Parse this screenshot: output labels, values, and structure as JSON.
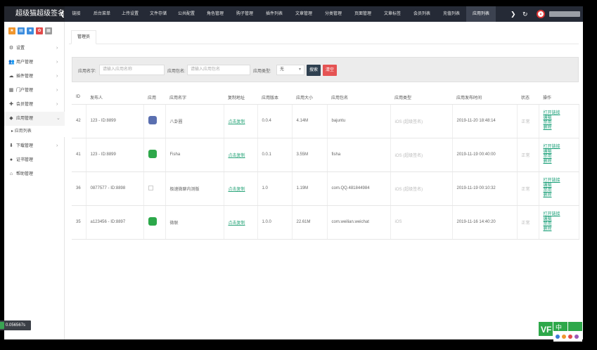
{
  "brand": {
    "title": "超级猫超级签名"
  },
  "nav": {
    "collapse_icon": "chevron-left-icon",
    "items": [
      {
        "label": "链接",
        "active": false
      },
      {
        "label": "后台菜单",
        "active": false
      },
      {
        "label": "上传设置",
        "active": false
      },
      {
        "label": "文件存储",
        "active": false
      },
      {
        "label": "公共配置",
        "active": false
      },
      {
        "label": "角色管理",
        "active": false
      },
      {
        "label": "购子管理",
        "active": false
      },
      {
        "label": "插件列表",
        "active": false
      },
      {
        "label": "文章管理",
        "active": false
      },
      {
        "label": "分类管理",
        "active": false
      },
      {
        "label": "页面管理",
        "active": false
      },
      {
        "label": "文章标签",
        "active": false
      },
      {
        "label": "会员列表",
        "active": false
      },
      {
        "label": "充值列表",
        "active": false
      },
      {
        "label": "应用列表",
        "active": true
      }
    ],
    "more_icon": "chevron-right-icon",
    "refresh_icon": "refresh-icon"
  },
  "sidebar": {
    "quick_icons": [
      {
        "icon": "star-icon",
        "color": "#f0962e"
      },
      {
        "icon": "file-icon",
        "color": "#3c8dde"
      },
      {
        "icon": "square-icon",
        "color": "#3c8dde"
      },
      {
        "icon": "lock-icon",
        "color": "#e24a4a"
      },
      {
        "icon": "grid-icon",
        "color": "#9b9b9b"
      }
    ],
    "menu": [
      {
        "label": "设置",
        "icon": "gear-icon"
      },
      {
        "label": "用户管理",
        "icon": "users-icon"
      },
      {
        "label": "插件管理",
        "icon": "cloud-icon"
      },
      {
        "label": "门户管理",
        "icon": "grid-icon"
      },
      {
        "label": "会员管理",
        "icon": "plus-icon"
      },
      {
        "label": "应用管理",
        "icon": "tag-icon"
      }
    ],
    "submenu": {
      "label": "应用列表"
    },
    "menu2": [
      {
        "label": "下载管理",
        "icon": "download-icon"
      },
      {
        "label": "证书管理",
        "icon": "circle-icon"
      },
      {
        "label": "帮助管理",
        "icon": "home-icon"
      }
    ],
    "status_text": "0.056567s"
  },
  "tab": {
    "label": "管理员"
  },
  "search": {
    "name_label": "应用名字:",
    "name_placeholder": "请输入应用名称",
    "pkg_label": "应用包名:",
    "pkg_placeholder": "请输入应用包名",
    "type_label": "应用类型:",
    "type_value": "无",
    "search_button": "搜索",
    "clear_button": "清空",
    "search_color": "#2f4050",
    "clear_color": "#e55353"
  },
  "table": {
    "headers": [
      "ID",
      "发布人",
      "应用",
      "应用名字",
      "复制地址",
      "应用版本",
      "应用大小",
      "应用包名",
      "应用类型",
      "应用发布时间",
      "状态",
      "操作"
    ],
    "rows": [
      {
        "id": "42",
        "publisher": "123 - ID:8899",
        "icon_color": "#5a6fb0",
        "name": "八卦圈",
        "copy": "点击复制",
        "version": "0.0.4",
        "size": "4.14M",
        "package": "bajuntu",
        "type": "iOS (超级签名)",
        "time": "2019-11-20 18:48:14",
        "status": "正常",
        "ops": [
          "打开链接",
          "编辑",
          "禁用",
          "删除"
        ]
      },
      {
        "id": "41",
        "publisher": "123 - ID:8899",
        "icon_color": "#2ea84a",
        "name": "Fisha",
        "copy": "点击复制",
        "version": "0.0.1",
        "size": "3.55M",
        "package": "fisha",
        "type": "iOS (超级签名)",
        "time": "2019-11-19 00:40:00",
        "status": "正常",
        "ops": [
          "打开链接",
          "编辑",
          "禁用",
          "删除"
        ]
      },
      {
        "id": "36",
        "publisher": "0877577 - ID:8898",
        "icon_color": "",
        "name": "极速微聊内测版",
        "copy": "点击复制",
        "version": "1.0",
        "size": "1.19M",
        "package": "com.QQ.481844984",
        "type": "iOS (超级签名)",
        "time": "2019-11-19 00:10:32",
        "status": "正常",
        "ops": [
          "打开链接",
          "编辑",
          "禁用",
          "删除"
        ]
      },
      {
        "id": "35",
        "publisher": "a123456 - ID:8897",
        "icon_color": "#2ca84a",
        "name": "微联",
        "copy": "点击复制",
        "version": "1.0.0",
        "size": "22.61M",
        "package": "com.weilian.weichat",
        "type": "iOS",
        "time": "2019-11-16 14:40:20",
        "status": "正常",
        "ops": [
          "打开链接",
          "编辑",
          "禁用",
          "删除"
        ]
      }
    ]
  },
  "corner": {
    "label": "VF",
    "badge": "中"
  }
}
